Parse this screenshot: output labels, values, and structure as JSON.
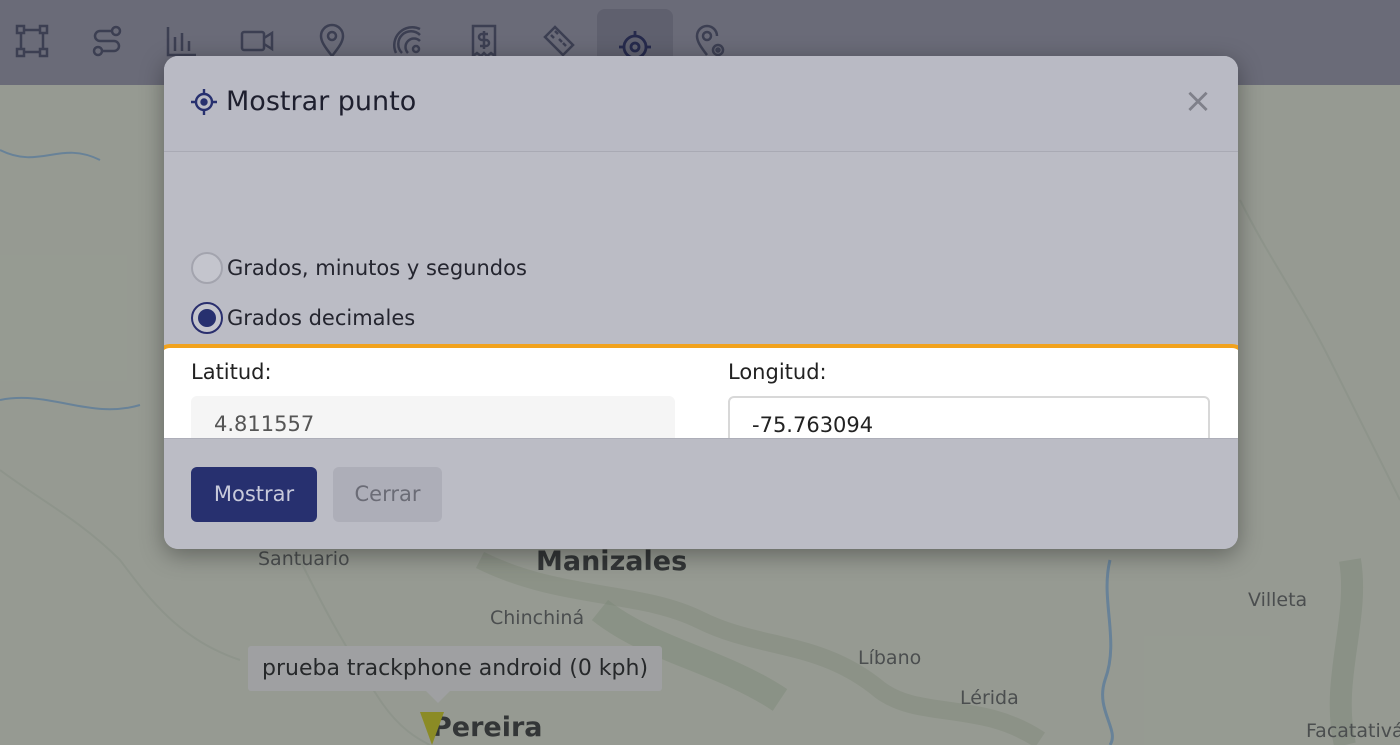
{
  "toolbar": {
    "tools": [
      {
        "icon": "polygon-select-icon"
      },
      {
        "icon": "route-icon"
      },
      {
        "icon": "bar-chart-icon"
      },
      {
        "icon": "video-camera-icon"
      },
      {
        "icon": "map-pin-icon"
      },
      {
        "icon": "satellite-dish-icon"
      },
      {
        "icon": "receipt-dollar-icon"
      },
      {
        "icon": "ruler-icon"
      },
      {
        "icon": "crosshair-icon",
        "active": true
      },
      {
        "icon": "pin-settings-icon"
      }
    ]
  },
  "modal": {
    "title": "Mostrar punto",
    "title_icon": "crosshair-icon",
    "close_label": "×",
    "radios": {
      "dms_label": "Grados, minutos y segundos",
      "decimal_label": "Grados decimales",
      "selected": "decimal"
    },
    "latitude": {
      "label": "Latitud:",
      "value": "4.811557"
    },
    "longitude": {
      "label": "Longitud:",
      "value": "-75.763094"
    },
    "buttons": {
      "show": "Mostrar",
      "close": "Cerrar"
    }
  },
  "map": {
    "places": {
      "santuario": "Santuario",
      "manizales": "Manizales",
      "chinchina": "Chinchiná",
      "villeta": "Villeta",
      "libano": "Líbano",
      "lerida": "Lérida",
      "pereira": "Pereira",
      "facatativa": "Facatativá"
    },
    "tooltip": "prueba trackphone android (0 kph)"
  },
  "colors": {
    "toolbar": "#6a6b78",
    "modal": "#bbbcc5",
    "primary": "#27306f",
    "highlight": "#f1a21d"
  }
}
